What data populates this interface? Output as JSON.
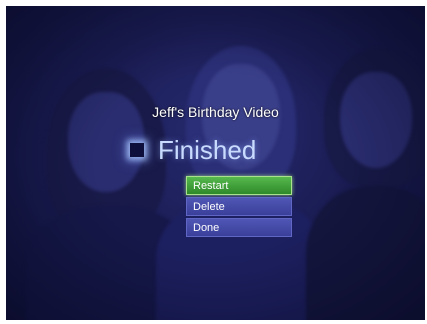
{
  "screen": {
    "title": "Jeff's Birthday Video",
    "status_icon": "stop-icon",
    "status": "Finished"
  },
  "menu": {
    "items": [
      {
        "label": "Restart",
        "selected": true
      },
      {
        "label": "Delete",
        "selected": false
      },
      {
        "label": "Done",
        "selected": false
      }
    ]
  },
  "colors": {
    "background": "#1b1d55",
    "selected_item": "#3f9c38",
    "menu_item": "#444ba6",
    "status_text": "#c9dcff"
  }
}
